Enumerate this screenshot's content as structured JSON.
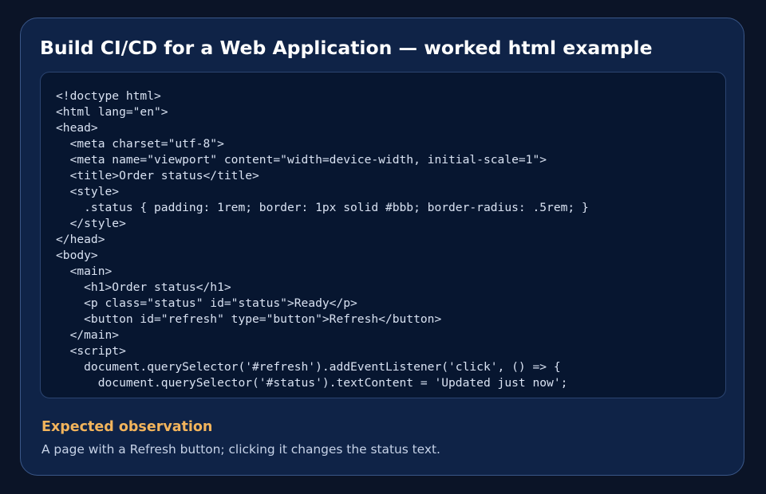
{
  "card": {
    "title": "Build CI/CD for a Web Application — worked html example"
  },
  "code": {
    "text": "<!doctype html>\n<html lang=\"en\">\n<head>\n  <meta charset=\"utf-8\">\n  <meta name=\"viewport\" content=\"width=device-width, initial-scale=1\">\n  <title>Order status</title>\n  <style>\n    .status { padding: 1rem; border: 1px solid #bbb; border-radius: .5rem; }\n  </style>\n</head>\n<body>\n  <main>\n    <h1>Order status</h1>\n    <p class=\"status\" id=\"status\">Ready</p>\n    <button id=\"refresh\" type=\"button\">Refresh</button>\n  </main>\n  <script>\n    document.querySelector('#refresh').addEventListener('click', () => {\n      document.querySelector('#status').textContent = 'Updated just now';"
  },
  "observation": {
    "heading": "Expected observation",
    "text": "A page with a Refresh button; clicking it changes the status text."
  },
  "colors": {
    "page_background": "#0b1427",
    "card_background": "#0f2347",
    "card_border": "#3a5788",
    "code_background": "#071630",
    "heading_accent": "#f2b45c"
  }
}
